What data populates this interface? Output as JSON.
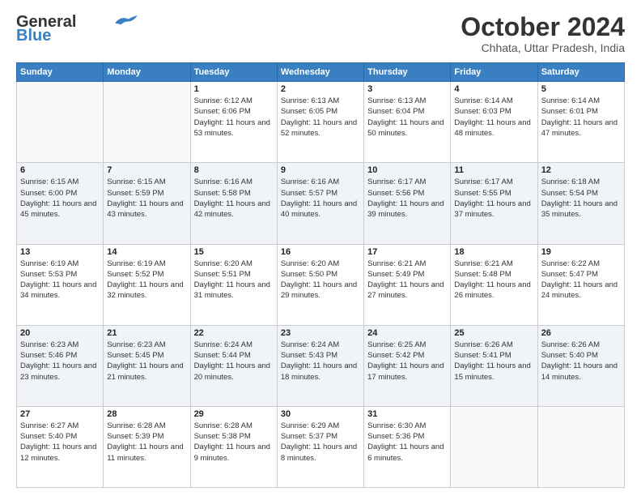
{
  "logo": {
    "line1": "General",
    "line2": "Blue"
  },
  "header": {
    "month": "October 2024",
    "location": "Chhata, Uttar Pradesh, India"
  },
  "weekdays": [
    "Sunday",
    "Monday",
    "Tuesday",
    "Wednesday",
    "Thursday",
    "Friday",
    "Saturday"
  ],
  "weeks": [
    [
      {
        "day": "",
        "info": ""
      },
      {
        "day": "",
        "info": ""
      },
      {
        "day": "1",
        "info": "Sunrise: 6:12 AM\nSunset: 6:06 PM\nDaylight: 11 hours and 53 minutes."
      },
      {
        "day": "2",
        "info": "Sunrise: 6:13 AM\nSunset: 6:05 PM\nDaylight: 11 hours and 52 minutes."
      },
      {
        "day": "3",
        "info": "Sunrise: 6:13 AM\nSunset: 6:04 PM\nDaylight: 11 hours and 50 minutes."
      },
      {
        "day": "4",
        "info": "Sunrise: 6:14 AM\nSunset: 6:03 PM\nDaylight: 11 hours and 48 minutes."
      },
      {
        "day": "5",
        "info": "Sunrise: 6:14 AM\nSunset: 6:01 PM\nDaylight: 11 hours and 47 minutes."
      }
    ],
    [
      {
        "day": "6",
        "info": "Sunrise: 6:15 AM\nSunset: 6:00 PM\nDaylight: 11 hours and 45 minutes."
      },
      {
        "day": "7",
        "info": "Sunrise: 6:15 AM\nSunset: 5:59 PM\nDaylight: 11 hours and 43 minutes."
      },
      {
        "day": "8",
        "info": "Sunrise: 6:16 AM\nSunset: 5:58 PM\nDaylight: 11 hours and 42 minutes."
      },
      {
        "day": "9",
        "info": "Sunrise: 6:16 AM\nSunset: 5:57 PM\nDaylight: 11 hours and 40 minutes."
      },
      {
        "day": "10",
        "info": "Sunrise: 6:17 AM\nSunset: 5:56 PM\nDaylight: 11 hours and 39 minutes."
      },
      {
        "day": "11",
        "info": "Sunrise: 6:17 AM\nSunset: 5:55 PM\nDaylight: 11 hours and 37 minutes."
      },
      {
        "day": "12",
        "info": "Sunrise: 6:18 AM\nSunset: 5:54 PM\nDaylight: 11 hours and 35 minutes."
      }
    ],
    [
      {
        "day": "13",
        "info": "Sunrise: 6:19 AM\nSunset: 5:53 PM\nDaylight: 11 hours and 34 minutes."
      },
      {
        "day": "14",
        "info": "Sunrise: 6:19 AM\nSunset: 5:52 PM\nDaylight: 11 hours and 32 minutes."
      },
      {
        "day": "15",
        "info": "Sunrise: 6:20 AM\nSunset: 5:51 PM\nDaylight: 11 hours and 31 minutes."
      },
      {
        "day": "16",
        "info": "Sunrise: 6:20 AM\nSunset: 5:50 PM\nDaylight: 11 hours and 29 minutes."
      },
      {
        "day": "17",
        "info": "Sunrise: 6:21 AM\nSunset: 5:49 PM\nDaylight: 11 hours and 27 minutes."
      },
      {
        "day": "18",
        "info": "Sunrise: 6:21 AM\nSunset: 5:48 PM\nDaylight: 11 hours and 26 minutes."
      },
      {
        "day": "19",
        "info": "Sunrise: 6:22 AM\nSunset: 5:47 PM\nDaylight: 11 hours and 24 minutes."
      }
    ],
    [
      {
        "day": "20",
        "info": "Sunrise: 6:23 AM\nSunset: 5:46 PM\nDaylight: 11 hours and 23 minutes."
      },
      {
        "day": "21",
        "info": "Sunrise: 6:23 AM\nSunset: 5:45 PM\nDaylight: 11 hours and 21 minutes."
      },
      {
        "day": "22",
        "info": "Sunrise: 6:24 AM\nSunset: 5:44 PM\nDaylight: 11 hours and 20 minutes."
      },
      {
        "day": "23",
        "info": "Sunrise: 6:24 AM\nSunset: 5:43 PM\nDaylight: 11 hours and 18 minutes."
      },
      {
        "day": "24",
        "info": "Sunrise: 6:25 AM\nSunset: 5:42 PM\nDaylight: 11 hours and 17 minutes."
      },
      {
        "day": "25",
        "info": "Sunrise: 6:26 AM\nSunset: 5:41 PM\nDaylight: 11 hours and 15 minutes."
      },
      {
        "day": "26",
        "info": "Sunrise: 6:26 AM\nSunset: 5:40 PM\nDaylight: 11 hours and 14 minutes."
      }
    ],
    [
      {
        "day": "27",
        "info": "Sunrise: 6:27 AM\nSunset: 5:40 PM\nDaylight: 11 hours and 12 minutes."
      },
      {
        "day": "28",
        "info": "Sunrise: 6:28 AM\nSunset: 5:39 PM\nDaylight: 11 hours and 11 minutes."
      },
      {
        "day": "29",
        "info": "Sunrise: 6:28 AM\nSunset: 5:38 PM\nDaylight: 11 hours and 9 minutes."
      },
      {
        "day": "30",
        "info": "Sunrise: 6:29 AM\nSunset: 5:37 PM\nDaylight: 11 hours and 8 minutes."
      },
      {
        "day": "31",
        "info": "Sunrise: 6:30 AM\nSunset: 5:36 PM\nDaylight: 11 hours and 6 minutes."
      },
      {
        "day": "",
        "info": ""
      },
      {
        "day": "",
        "info": ""
      }
    ]
  ]
}
